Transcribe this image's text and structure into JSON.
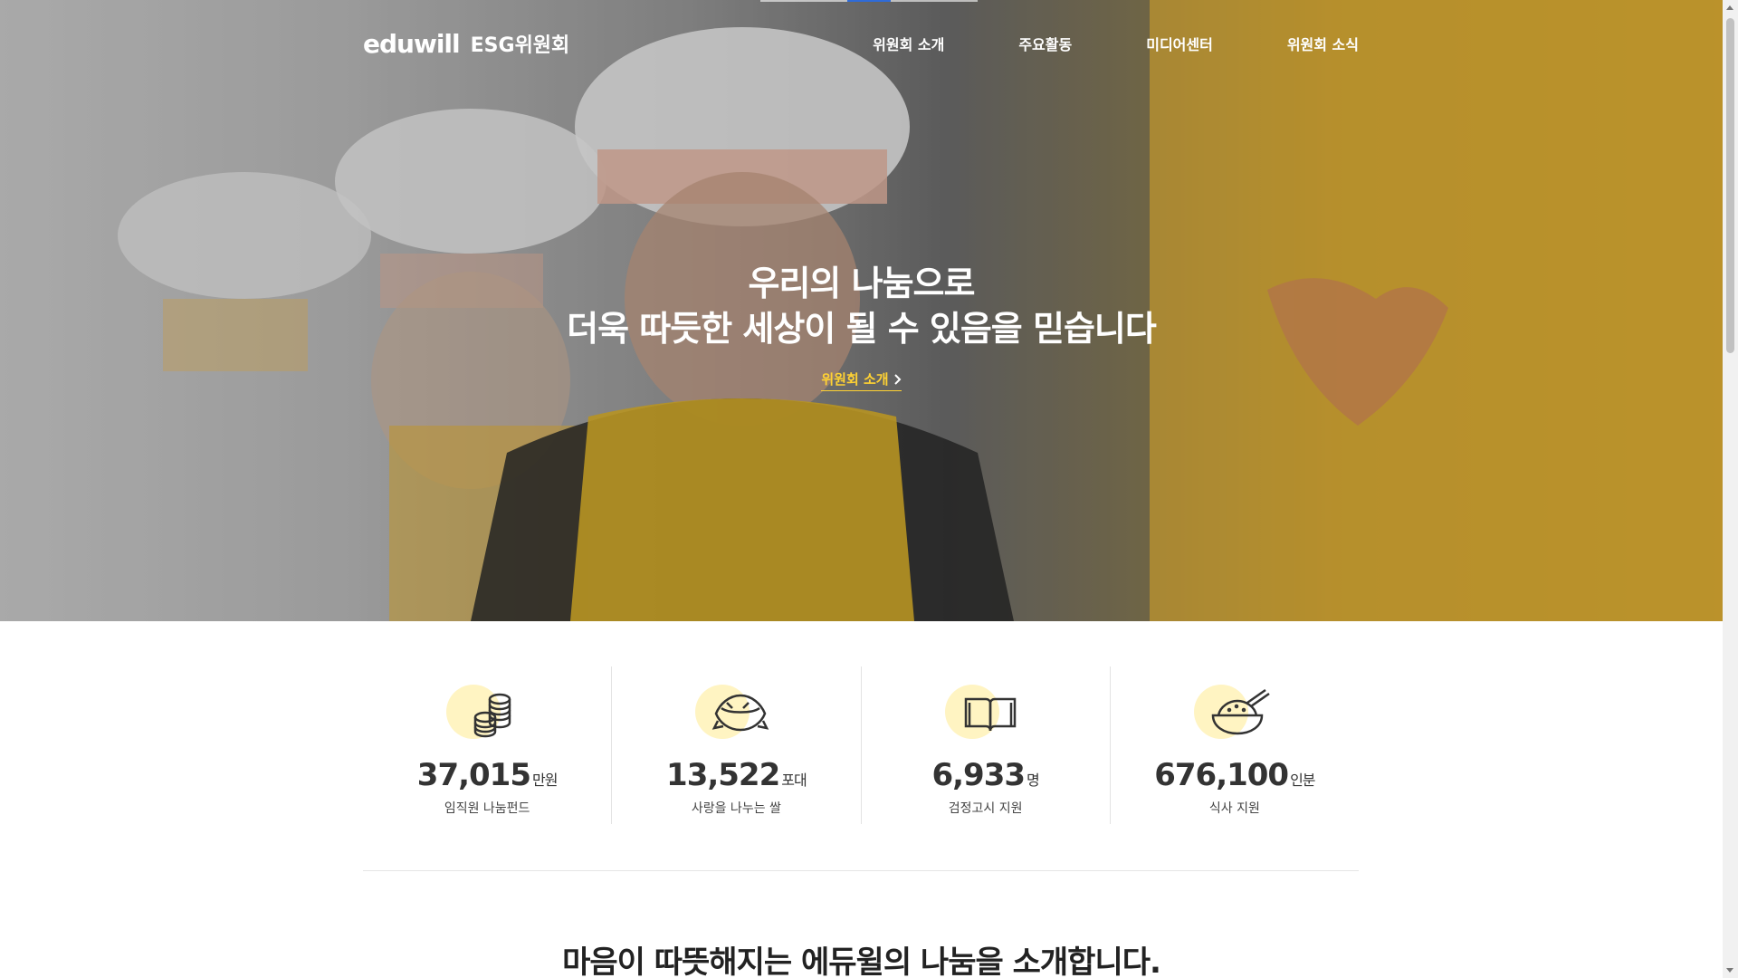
{
  "header": {
    "logo_text": "eduwill",
    "title": "ESG위원회",
    "nav": [
      {
        "label": "위원회 소개"
      },
      {
        "label": "주요활동"
      },
      {
        "label": "미디어센터"
      },
      {
        "label": "위원회 소식"
      }
    ]
  },
  "hero": {
    "line1": "우리의 나눔으로",
    "line2": "더욱 따듯한 세상이 될 수 있음을 믿습니다",
    "link_label": "위원회 소개"
  },
  "stats": [
    {
      "icon": "coins-icon",
      "value": "37,015",
      "unit": "만원",
      "label": "임직원 나눔펀드"
    },
    {
      "icon": "rice-bag-icon",
      "value": "13,522",
      "unit": "포대",
      "label": "사랑을 나누는 쌀"
    },
    {
      "icon": "book-icon",
      "value": "6,933",
      "unit": "명",
      "label": "검정고시 지원"
    },
    {
      "icon": "rice-bowl-icon",
      "value": "676,100",
      "unit": "인분",
      "label": "식사 지원"
    }
  ],
  "intro": {
    "heading": "마음이 따뜻해지는 에듀윌의 나눔을 소개합니다."
  },
  "colors": {
    "accent_yellow": "#ffd233",
    "icon_circle": "#fff4c2",
    "scroll_indicator": "#2f6bd8"
  }
}
